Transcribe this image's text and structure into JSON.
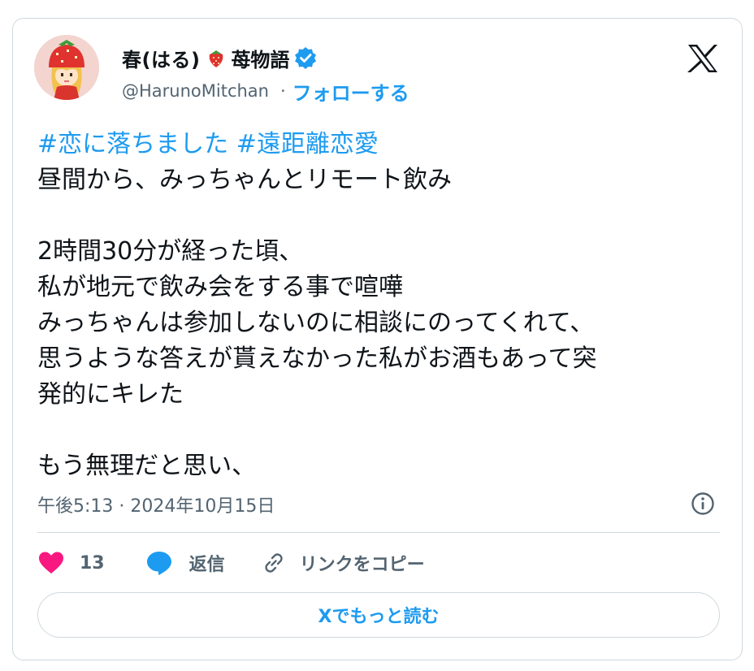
{
  "author": {
    "display_name": "春(はる)",
    "display_name_suffix": "苺物語",
    "handle": "@HarunoMitchan",
    "separator": "·",
    "follow_label": "フォローする",
    "avatar_icon": "strawberry-hat-girl-avatar",
    "verified_icon": "verified-badge-icon"
  },
  "tweet": {
    "hashtags": [
      "#恋に落ちました",
      "#遠距離恋愛"
    ],
    "lines": [
      "昼間から、みっちゃんとリモート飲み",
      "",
      "2時間30分が経った頃、",
      "私が地元で飲み会をする事で喧嘩",
      "みっちゃんは参加しないのに相談にのってくれて、",
      "思うような答えが貰えなかった私がお酒もあって突",
      "発的にキレた",
      "",
      "もう無理だと思い、"
    ],
    "timestamp": "午後5:13 · 2024年10月15日"
  },
  "actions": {
    "like_count": "13",
    "reply_label": "返信",
    "copy_link_label": "リンクをコピー"
  },
  "read_more_label": "Xでもっと読む",
  "colors": {
    "accent": "#1d9bf0",
    "text": "#0f1419",
    "muted": "#536471",
    "like": "#f91880",
    "border": "#cfd9de"
  }
}
